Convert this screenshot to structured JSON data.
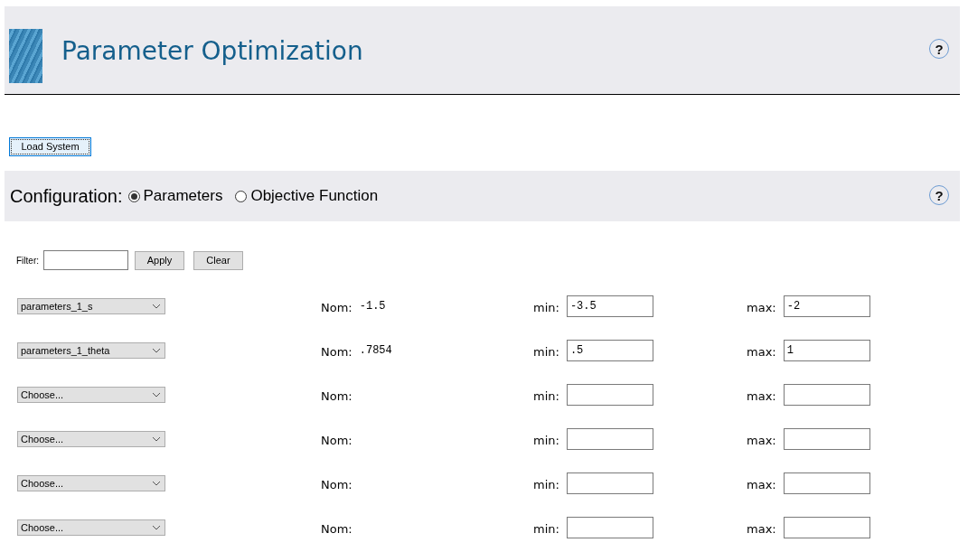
{
  "header": {
    "title": "Parameter Optimization",
    "help": "?"
  },
  "load_button": "Load System",
  "configuration": {
    "label": "Configuration:",
    "help": "?",
    "options": [
      {
        "label": "Parameters",
        "selected": true
      },
      {
        "label": "Objective Function",
        "selected": false
      }
    ]
  },
  "filter": {
    "label": "Filter:",
    "buttons": [
      "Apply",
      "Clear"
    ]
  },
  "parameters": [
    {
      "parameter": "parameters_1_s",
      "nom_label": "Nom:",
      "nom": "-1.5",
      "min_label": "min:",
      "min": "-3.5",
      "max_label": "max:",
      "max": "-2"
    },
    {
      "parameter": "parameters_1_theta",
      "nom_label": "Nom:",
      "nom": ".7854",
      "min_label": "min:",
      "min": ".5",
      "max_label": "max:",
      "max": "1"
    },
    {
      "parameter": "Choose...",
      "nom_label": "Nom:",
      "min_label": "min:",
      "max_label": "max:"
    },
    {
      "parameter": "Choose...",
      "nom_label": "Nom:",
      "min_label": "min:",
      "max_label": "max:"
    },
    {
      "parameter": "Choose...",
      "nom_label": "Nom:",
      "min_label": "min:",
      "max_label": "max:"
    },
    {
      "parameter": "Choose...",
      "nom_label": "Nom:",
      "min_label": "min:",
      "max_label": "max:"
    }
  ]
}
